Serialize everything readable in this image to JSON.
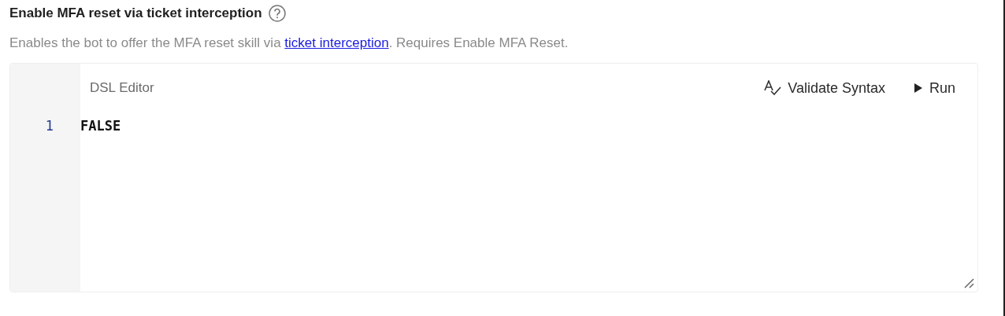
{
  "setting": {
    "title": "Enable MFA reset via ticket interception",
    "description_before": "Enables the bot to offer the MFA reset skill via ",
    "description_link": "ticket interception",
    "description_after": ". Requires Enable MFA Reset."
  },
  "editor": {
    "title": "DSL Editor",
    "actions": [
      {
        "kind": "validate",
        "label": "Validate Syntax"
      },
      {
        "kind": "run",
        "label": "Run"
      }
    ],
    "lines": [
      {
        "number": "1",
        "text": "FALSE"
      }
    ]
  }
}
